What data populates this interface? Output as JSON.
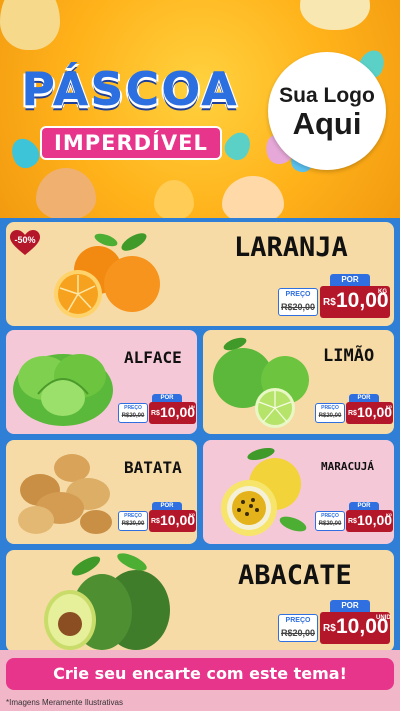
{
  "header": {
    "title": "PÁSCOA",
    "subtitle": "IMPERDÍVEL",
    "logo_line1": "Sua Logo",
    "logo_line2": "Aqui"
  },
  "badge": {
    "discount": "-50%"
  },
  "products": {
    "laranja": {
      "name": "LARANJA",
      "por": "POR",
      "preco_label": "PREÇO",
      "old_price": "R$20,00",
      "currency": "R$",
      "new_price": "10,00",
      "unit": "KG"
    },
    "alface": {
      "name": "ALFACE",
      "por": "POR",
      "preco_label": "PREÇO",
      "old_price": "R$20,00",
      "currency": "R$",
      "new_price": "10,00",
      "unit": "UN"
    },
    "limao": {
      "name": "LIMÃO",
      "por": "POR",
      "preco_label": "PREÇO",
      "old_price": "R$20,00",
      "currency": "R$",
      "new_price": "10,00",
      "unit": "KG"
    },
    "batata": {
      "name": "BATATA",
      "por": "POR",
      "preco_label": "PREÇO",
      "old_price": "R$20,00",
      "currency": "R$",
      "new_price": "10,00",
      "unit": "KG"
    },
    "maracuja": {
      "name": "MARACUJÁ",
      "por": "POR",
      "preco_label": "PREÇO",
      "old_price": "R$20,00",
      "currency": "R$",
      "new_price": "10,00",
      "unit": "KG"
    },
    "abacate": {
      "name": "ABACATE",
      "por": "POR",
      "preco_label": "PREÇO",
      "old_price": "R$20,00",
      "currency": "R$",
      "new_price": "10,00",
      "unit": "UNID"
    }
  },
  "cta": {
    "label": "Crie seu encarte com este tema!"
  },
  "disclaimer": "*Imagens Meramente Ilustrativas",
  "colors": {
    "header": "#ffb21a",
    "title": "#2b6fe0",
    "subtitle_bg": "#e8358c",
    "card_peach": "#f7dba6",
    "card_pink": "#f5c8d8",
    "price_new": "#b5172a",
    "price_tag": "#2f6fe0"
  }
}
